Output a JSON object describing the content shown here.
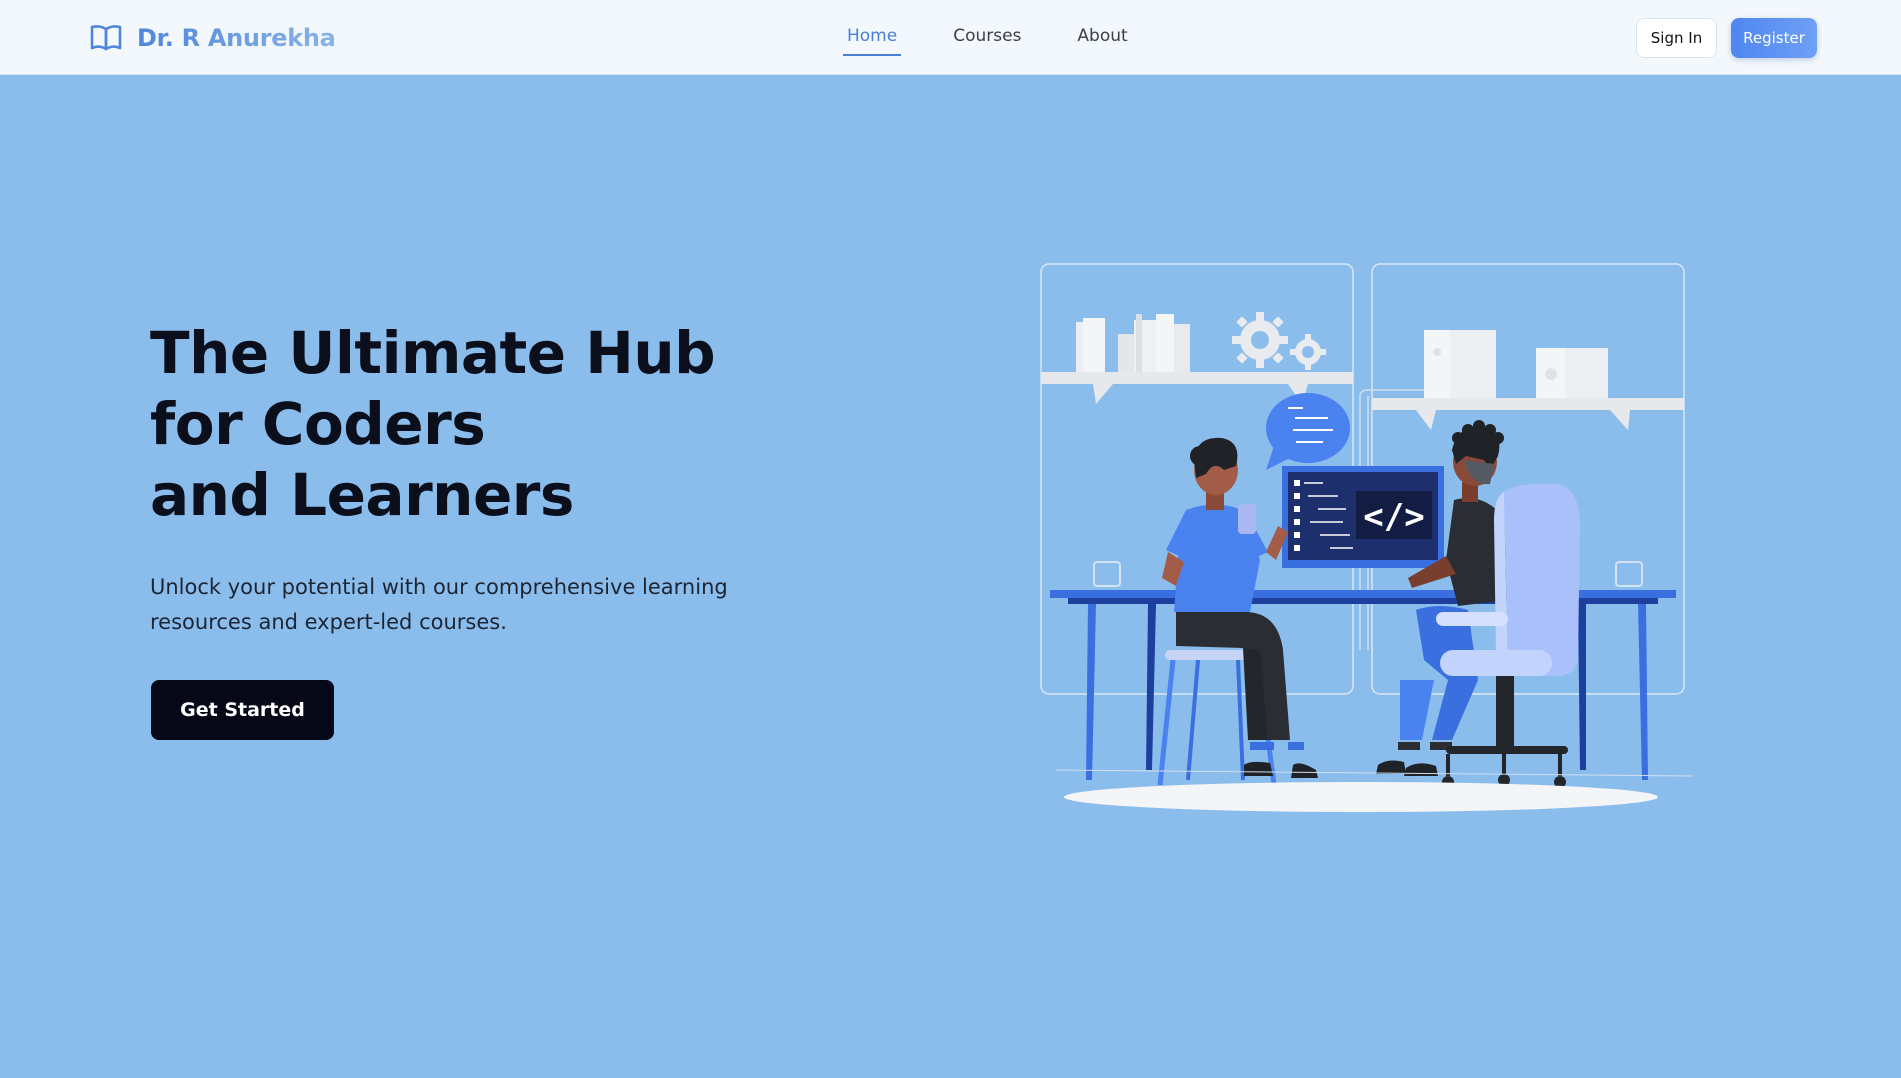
{
  "header": {
    "brand_icon": "open-book-icon",
    "brand_name": "Dr. R Anurekha",
    "nav": [
      {
        "label": "Home",
        "active": true
      },
      {
        "label": "Courses",
        "active": false
      },
      {
        "label": "About",
        "active": false
      }
    ],
    "sign_in_label": "Sign In",
    "register_label": "Register"
  },
  "hero": {
    "title_lines": [
      "The Ultimate Hub",
      "for Coders",
      "and Learners"
    ],
    "subtitle": "Unlock your potential with our comprehensive learning resources and expert-led courses.",
    "cta_label": "Get Started",
    "illustration_code_symbol": "</>"
  },
  "colors": {
    "background": "#8bbdec",
    "header_bg": "#f3f8fc",
    "accent": "#4a7fd6",
    "cta_bg": "#060818",
    "register_bg": "#5a8ff2"
  }
}
